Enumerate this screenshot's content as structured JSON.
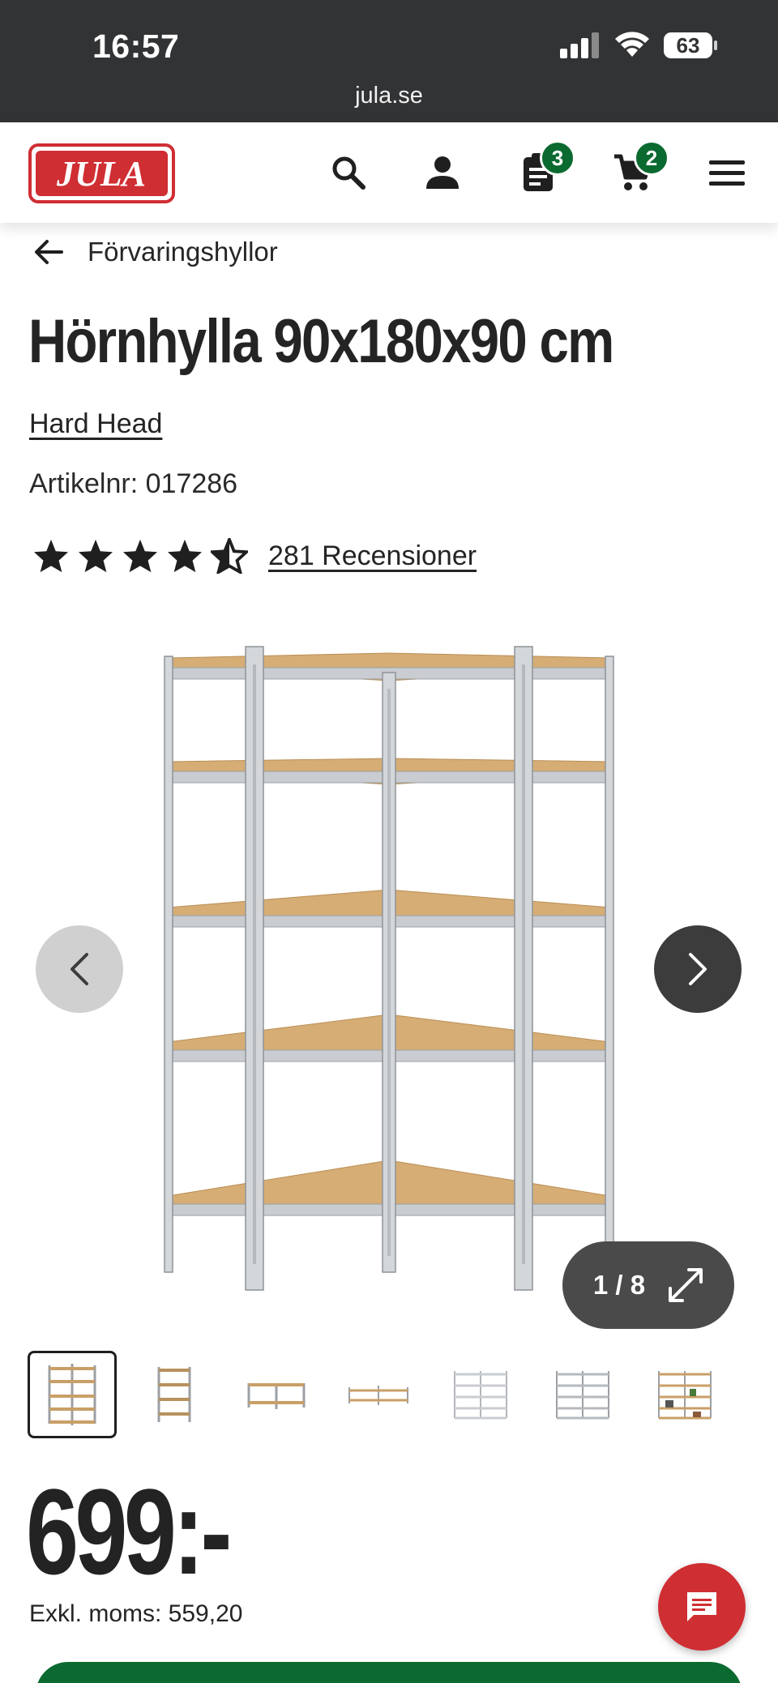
{
  "status_bar": {
    "time": "16:57",
    "battery": "63",
    "url": "jula.se"
  },
  "header": {
    "logo_text": "JULA",
    "icons": [
      "search-icon",
      "user-icon",
      "list-icon",
      "cart-icon",
      "menu-icon"
    ],
    "list_badge": "3",
    "cart_badge": "2"
  },
  "breadcrumb": {
    "label": "Förvaringshyllor"
  },
  "product": {
    "title": "Hörnhylla 90x180x90 cm",
    "brand": "Hard Head",
    "article": "Artikelnr: 017286",
    "rating": 4.5,
    "reviews": "281 Recensioner",
    "price": "699:-",
    "price_ex_vat": "Exkl. moms: 559,20"
  },
  "gallery": {
    "counter": "1 / 8",
    "thumbnail_count": 7
  },
  "colors": {
    "brand_red": "#cf2e33",
    "brand_green": "#0b6a2f",
    "statusbar": "#323335"
  }
}
